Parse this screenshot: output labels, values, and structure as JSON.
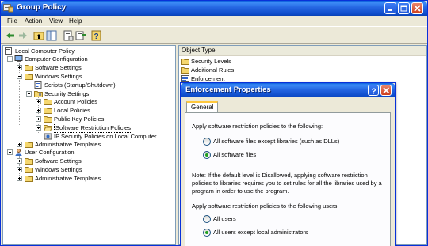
{
  "window": {
    "title": "Group Policy"
  },
  "menu": {
    "file": "File",
    "action": "Action",
    "view": "View",
    "help": "Help"
  },
  "tree": {
    "root": "Local Computer Policy",
    "computer_config": "Computer Configuration",
    "cc_software_settings": "Software Settings",
    "cc_windows_settings": "Windows Settings",
    "scripts": "Scripts (Startup/Shutdown)",
    "security_settings": "Security Settings",
    "account_policies": "Account Policies",
    "local_policies": "Local Policies",
    "public_key_policies": "Public Key Policies",
    "software_restriction_policies": "Software Restriction Policies",
    "ip_security_policies": "IP Security Policies on Local Computer",
    "cc_admin_templates": "Administrative Templates",
    "user_config": "User Configuration",
    "uc_software_settings": "Software Settings",
    "uc_windows_settings": "Windows Settings",
    "uc_admin_templates": "Administrative Templates"
  },
  "list": {
    "column_header": "Object Type",
    "items": [
      "Security Levels",
      "Additional Rules",
      "Enforcement"
    ]
  },
  "dialog": {
    "title": "Enforcement Properties",
    "tab": "General",
    "section1_label": "Apply software restriction policies to the following:",
    "option_except_libraries": "All software files except libraries (such as DLLs)",
    "option_all_files": "All software files",
    "note": "Note:  If the default level is Disallowed, applying software restriction policies to libraries requires you to set rules for all the libraries used by a program in order to use the program.",
    "section2_label": "Apply software restriction policies to the following users:",
    "option_all_users": "All users",
    "option_except_admins": "All users except local administrators"
  },
  "colors": {
    "titlebar": "#2566E2",
    "window_face": "#ECE9D8",
    "radio_dot": "#21A121"
  }
}
